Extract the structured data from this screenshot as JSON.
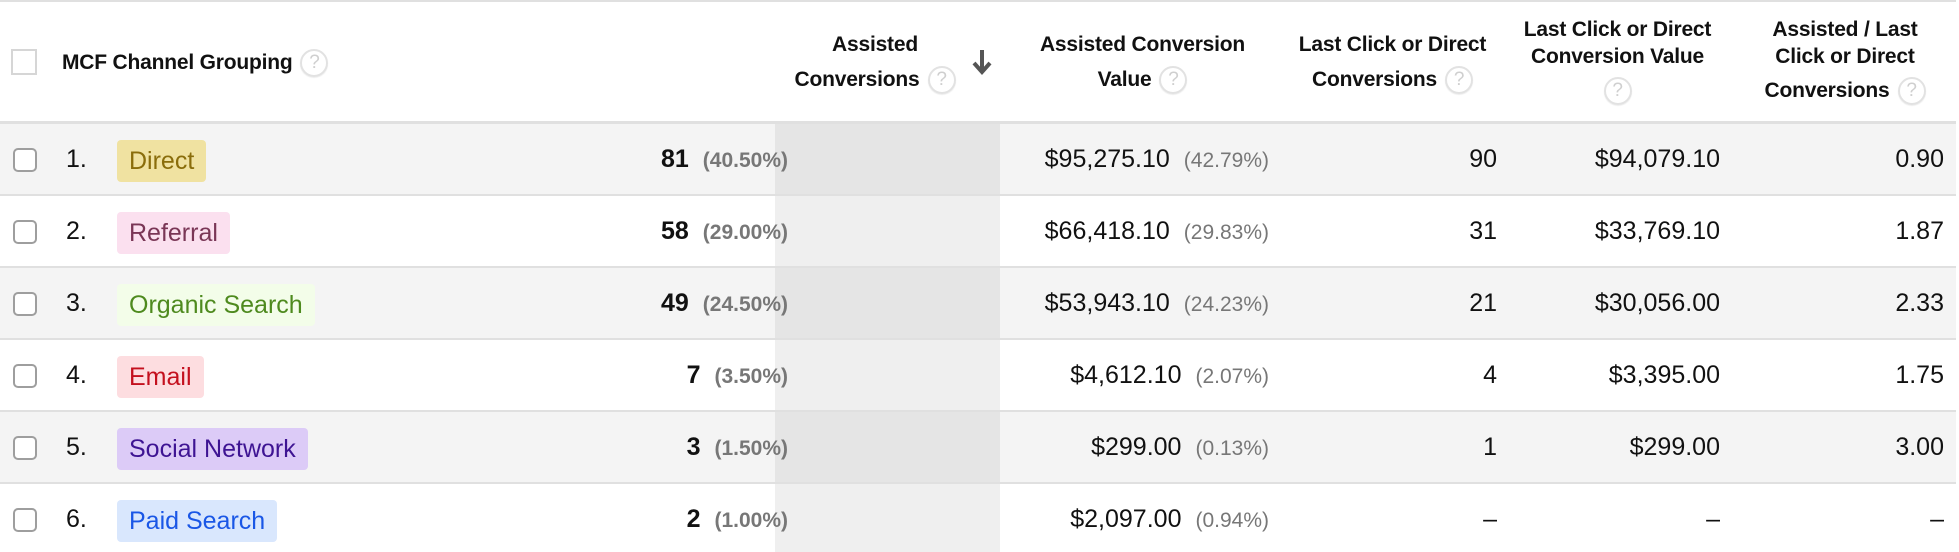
{
  "header": {
    "dimension_label": "MCF Channel Grouping",
    "columns": [
      {
        "line1": "Assisted",
        "line2": "Conversions",
        "sorted": "descending"
      },
      {
        "line1": "Assisted Conversion",
        "line2": "Value"
      },
      {
        "line1": "Last Click or Direct",
        "line2": "Conversions"
      },
      {
        "line1": "Last Click or Direct",
        "line2": "Conversion Value"
      },
      {
        "line1": "Assisted / Last",
        "line2": "Click or Direct",
        "line3": "Conversions"
      }
    ],
    "help_icon_glyph": "?"
  },
  "rows": [
    {
      "index": "1.",
      "channel": "Direct",
      "badge_bg": "#f0e2a1",
      "badge_fg": "#8a6d0b",
      "assisted_conversions": "81",
      "assisted_conversions_pct": "(40.50%)",
      "assisted_value": "$95,275.10",
      "assisted_value_pct": "(42.79%)",
      "last_click_conversions": "90",
      "last_click_value": "$94,079.10",
      "ratio": "0.90"
    },
    {
      "index": "2.",
      "channel": "Referral",
      "badge_bg": "#fbe0ef",
      "badge_fg": "#7a3656",
      "assisted_conversions": "58",
      "assisted_conversions_pct": "(29.00%)",
      "assisted_value": "$66,418.10",
      "assisted_value_pct": "(29.83%)",
      "last_click_conversions": "31",
      "last_click_value": "$33,769.10",
      "ratio": "1.87"
    },
    {
      "index": "3.",
      "channel": "Organic Search",
      "badge_bg": "#f3fde9",
      "badge_fg": "#4e8a1e",
      "assisted_conversions": "49",
      "assisted_conversions_pct": "(24.50%)",
      "assisted_value": "$53,943.10",
      "assisted_value_pct": "(24.23%)",
      "last_click_conversions": "21",
      "last_click_value": "$30,056.00",
      "ratio": "2.33"
    },
    {
      "index": "4.",
      "channel": "Email",
      "badge_bg": "#fddde0",
      "badge_fg": "#c4101e",
      "assisted_conversions": "7",
      "assisted_conversions_pct": "(3.50%)",
      "assisted_value": "$4,612.10",
      "assisted_value_pct": "(2.07%)",
      "last_click_conversions": "4",
      "last_click_value": "$3,395.00",
      "ratio": "1.75"
    },
    {
      "index": "5.",
      "channel": "Social Network",
      "badge_bg": "#dccbf7",
      "badge_fg": "#3e1493",
      "assisted_conversions": "3",
      "assisted_conversions_pct": "(1.50%)",
      "assisted_value": "$299.00",
      "assisted_value_pct": "(0.13%)",
      "last_click_conversions": "1",
      "last_click_value": "$299.00",
      "ratio": "3.00"
    },
    {
      "index": "6.",
      "channel": "Paid Search",
      "badge_bg": "#d9e7fd",
      "badge_fg": "#1a57e6",
      "assisted_conversions": "2",
      "assisted_conversions_pct": "(1.00%)",
      "assisted_value": "$2,097.00",
      "assisted_value_pct": "(0.94%)",
      "last_click_conversions": "–",
      "last_click_value": "–",
      "ratio": "–"
    }
  ]
}
